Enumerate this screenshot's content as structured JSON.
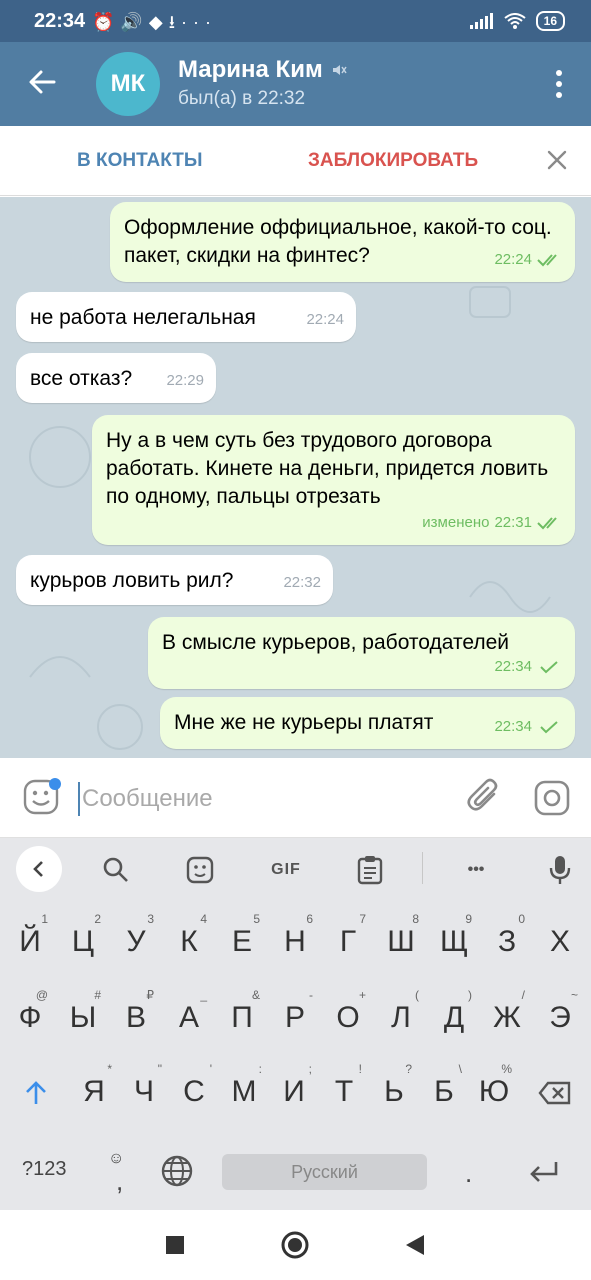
{
  "status_bar": {
    "time": "22:34",
    "icons": [
      "alarm-icon",
      "sound-icon",
      "app-icon",
      "download-icon",
      "more-icon"
    ],
    "more": "···",
    "battery": "16"
  },
  "header": {
    "avatar_initials": "МК",
    "avatar_color": "#4cb7cd",
    "contact_name": "Марина Ким",
    "last_seen": "был(а) в 22:32",
    "bar_color": "#517da2"
  },
  "actions": {
    "add_contact": "В КОНТАКТЫ",
    "block": "ЗАБЛОКИРОВАТЬ"
  },
  "messages": [
    {
      "direction": "out",
      "text": "Оформление оффициальное, какой-то соц. пакет, скидки на финтес?",
      "time": "22:24",
      "edited": "",
      "read": true
    },
    {
      "direction": "in",
      "text": "не работа нелегальная",
      "time": "22:24"
    },
    {
      "direction": "in",
      "text": "все отказ?",
      "time": "22:29"
    },
    {
      "direction": "out",
      "text": "Ну а в чем суть без трудового договора работать. Кинете на деньги, придется ловить по одному, пальцы отрезать",
      "time": "22:31",
      "edited": "изменено",
      "read": true
    },
    {
      "direction": "in",
      "text": "курьров ловить рил?",
      "time": "22:32"
    },
    {
      "direction": "out",
      "text": "В смысле курьеров, работодателей",
      "time": "22:34",
      "edited": "",
      "read": false
    },
    {
      "direction": "out",
      "text": "Мне же не курьеры платят",
      "time": "22:34",
      "edited": "",
      "read": false
    }
  ],
  "composer": {
    "placeholder": "Сообщение"
  },
  "keyboard": {
    "toolbar": {
      "gif": "GIF",
      "more": "•••"
    },
    "row1": [
      {
        "k": "Й",
        "h": "1"
      },
      {
        "k": "Ц",
        "h": "2"
      },
      {
        "k": "У",
        "h": "3"
      },
      {
        "k": "К",
        "h": "4"
      },
      {
        "k": "Е",
        "h": "5"
      },
      {
        "k": "Н",
        "h": "6"
      },
      {
        "k": "Г",
        "h": "7"
      },
      {
        "k": "Ш",
        "h": "8"
      },
      {
        "k": "Щ",
        "h": "9"
      },
      {
        "k": "З",
        "h": "0"
      },
      {
        "k": "Х",
        "h": ""
      }
    ],
    "row2": [
      {
        "k": "Ф",
        "h": "@"
      },
      {
        "k": "Ы",
        "h": "#"
      },
      {
        "k": "В",
        "h": "₽"
      },
      {
        "k": "А",
        "h": "_"
      },
      {
        "k": "П",
        "h": "&"
      },
      {
        "k": "Р",
        "h": "-"
      },
      {
        "k": "О",
        "h": "+"
      },
      {
        "k": "Л",
        "h": "("
      },
      {
        "k": "Д",
        "h": ")"
      },
      {
        "k": "Ж",
        "h": "/"
      },
      {
        "k": "Э",
        "h": "~"
      }
    ],
    "row3": [
      {
        "k": "Я",
        "h": "*"
      },
      {
        "k": "Ч",
        "h": "\""
      },
      {
        "k": "С",
        "h": "'"
      },
      {
        "k": "М",
        "h": ":"
      },
      {
        "k": "И",
        "h": ";"
      },
      {
        "k": "Т",
        "h": "!"
      },
      {
        "k": "Ь",
        "h": "?"
      },
      {
        "k": "Б",
        "h": "\\"
      },
      {
        "k": "Ю",
        "h": "%"
      }
    ],
    "symbols_key": "?123",
    "emoji_key": "☺",
    "comma_key": ",",
    "space_label": "Русский",
    "period_key": ".",
    "accent_color": "#3b8eea"
  }
}
